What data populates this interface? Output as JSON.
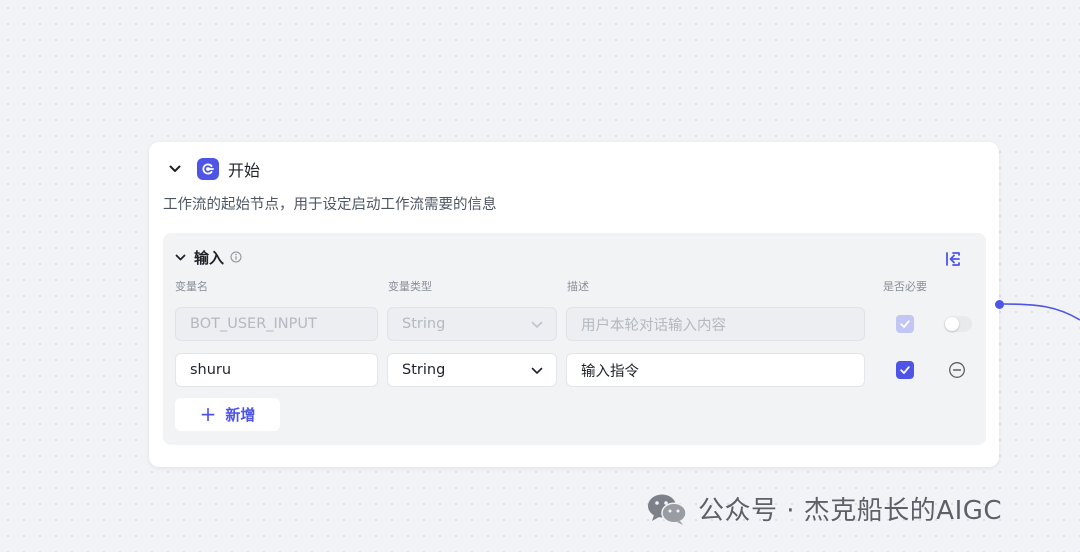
{
  "node": {
    "title": "开始",
    "description": "工作流的起始节点，用于设定启动工作流需要的信息",
    "icon": "start-node-icon",
    "accent": "#4e55e6"
  },
  "inputs": {
    "title": "输入",
    "columns": {
      "name": "变量名",
      "type": "变量类型",
      "description": "描述",
      "required": "是否必要"
    },
    "rows": [
      {
        "name": "BOT_USER_INPUT",
        "type": "String",
        "description": "用户本轮对话输入内容",
        "required": true,
        "disabled": true,
        "toggle_on": false
      },
      {
        "name": "shuru",
        "type": "String",
        "description": "输入指令",
        "required": true,
        "disabled": false
      }
    ],
    "add_label": "新增"
  },
  "watermark": {
    "text": "公众号 · 杰克船长的AIGC"
  }
}
